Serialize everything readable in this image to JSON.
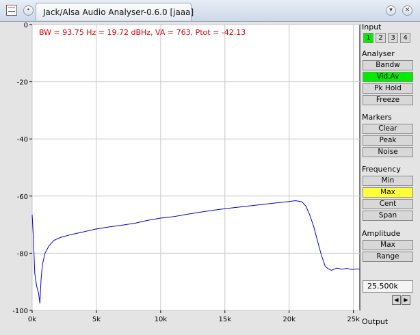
{
  "window": {
    "title": "Jack/Alsa Audio Analyser-0.6.0  [jaaa]"
  },
  "plot": {
    "status_text": "BW = 93.75 Hz = 19.72 dBHz, VA = 763, Ptot = -42.13",
    "trace_color": "#0000cc",
    "status_color": "#e00000"
  },
  "chart_data": {
    "type": "line",
    "x_unit": "Hz",
    "y_unit": "dB",
    "xlim": [
      0,
      25500
    ],
    "ylim": [
      -100,
      0
    ],
    "grid": true,
    "x_ticks": [
      {
        "value": 0,
        "label": "0k"
      },
      {
        "value": 5000,
        "label": "5k"
      },
      {
        "value": 10000,
        "label": "10k"
      },
      {
        "value": 15000,
        "label": "15k"
      },
      {
        "value": 20000,
        "label": "20k"
      },
      {
        "value": 25000,
        "label": "25k"
      }
    ],
    "y_ticks": [
      {
        "value": 0,
        "label": "0"
      },
      {
        "value": -20,
        "label": "-20"
      },
      {
        "value": -40,
        "label": "-40"
      },
      {
        "value": -60,
        "label": "-60"
      },
      {
        "value": -80,
        "label": "-80"
      },
      {
        "value": -100,
        "label": "-100"
      }
    ],
    "series": [
      {
        "x": [
          0,
          100,
          200,
          350,
          500,
          600,
          700,
          800,
          1000,
          1300,
          1700,
          2200,
          3000,
          4000,
          5000,
          6000,
          7000,
          8000,
          9000,
          10000,
          11000,
          12000,
          13000,
          14000,
          15000,
          16000,
          17000,
          18000,
          19000,
          20000,
          20500,
          21000,
          21300,
          21600,
          21900,
          22200,
          22500,
          22800,
          23000,
          23300,
          23700,
          24100,
          24500,
          24900,
          25300,
          25500
        ],
        "y": [
          -66.5,
          -75,
          -87,
          -91.5,
          -94,
          -97.5,
          -89,
          -84,
          -80,
          -77.5,
          -75.5,
          -74.5,
          -73.5,
          -72.5,
          -71.5,
          -70.8,
          -70.2,
          -69.5,
          -68.5,
          -67.7,
          -67.2,
          -66.4,
          -65.7,
          -65,
          -64.4,
          -63.9,
          -63.4,
          -62.9,
          -62.4,
          -61.9,
          -61.6,
          -62,
          -63.5,
          -66.5,
          -70.5,
          -75.5,
          -80.5,
          -84.5,
          -85.3,
          -86,
          -85.2,
          -85.6,
          -85.3,
          -85.7,
          -85.5,
          -85.6
        ]
      }
    ]
  },
  "side_panel": {
    "input": {
      "label": "Input",
      "buttons": [
        "1",
        "2",
        "3",
        "4"
      ],
      "active": "1"
    },
    "analyser": {
      "label": "Analyser",
      "bandw": "Bandw",
      "vidav": "Vid.Av",
      "pkhold": "Pk Hold",
      "freeze": "Freeze"
    },
    "markers": {
      "label": "Markers",
      "clear": "Clear",
      "peak": "Peak",
      "noise": "Noise"
    },
    "frequency": {
      "label": "Frequency",
      "min": "Min",
      "max": "Max",
      "cent": "Cent",
      "span": "Span"
    },
    "amplitude": {
      "label": "Amplitude",
      "max": "Max",
      "range": "Range"
    },
    "readout_value": "25.500k",
    "arrow_left": "◀",
    "arrow_right": "▶",
    "output_label": "Output",
    "active_color": "#00ee00",
    "highlight_color": "#ffff33"
  }
}
